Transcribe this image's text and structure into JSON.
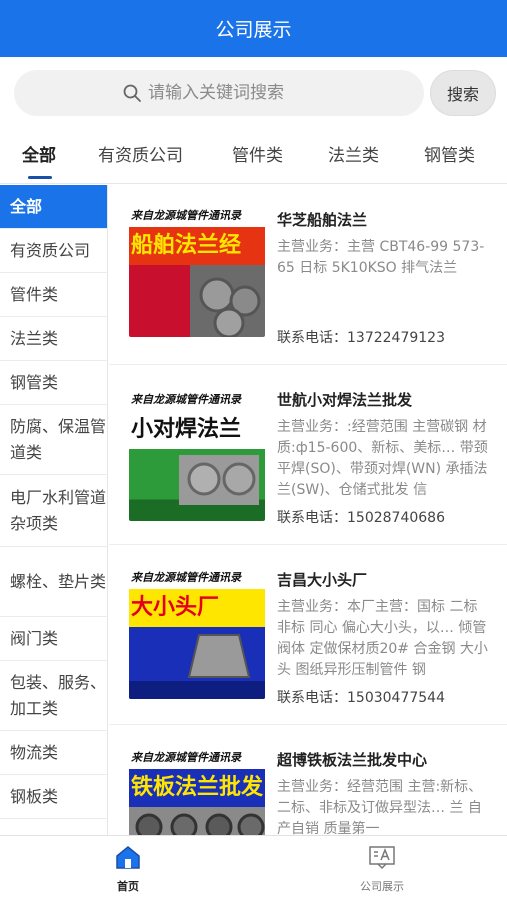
{
  "header": {
    "title": "公司展示"
  },
  "search": {
    "placeholder": "请输入关键词搜索",
    "button_label": "搜索"
  },
  "tabs": [
    {
      "label": "全部",
      "active": true
    },
    {
      "label": "有资质公司"
    },
    {
      "label": "管件类"
    },
    {
      "label": "法兰类"
    },
    {
      "label": "钢管类"
    }
  ],
  "sidebar": {
    "items": [
      {
        "label": "全部",
        "active": true
      },
      {
        "label": "有资质公司"
      },
      {
        "label": "管件类"
      },
      {
        "label": "法兰类"
      },
      {
        "label": "钢管类"
      },
      {
        "label": "防腐、保温管道类"
      },
      {
        "label": "电厂水利管道杂项类"
      },
      {
        "label": "螺栓、垫片类"
      },
      {
        "label": "阀门类"
      },
      {
        "label": "包装、服务、加工类"
      },
      {
        "label": "物流类"
      },
      {
        "label": "钢板类"
      }
    ]
  },
  "companies": [
    {
      "name": "华芝船舶法兰",
      "description": "主营业务：主营 CBT46-99 573-65 日标 5K10KSO 排气法兰",
      "phone": "联系电话：13722479123",
      "thumb_header": "来自龙源城管件通讯录",
      "thumb_title": "船舶法兰经",
      "thumb_colors": {
        "top": "#e63312",
        "bottom": "#c8102e",
        "title": "#ffe600"
      }
    },
    {
      "name": "世航小对焊法兰批发",
      "description": "主营业务：:经营范围 主营碳钢 材质:ф15-600、新标、美标… 带颈平焊(SO)、带颈对焊(WN) 承插法兰(SW)、仓储式批发 信",
      "phone": "联系电话：15028740686",
      "thumb_header": "来自龙源城管件通讯录",
      "thumb_title": "小对焊法兰",
      "thumb_colors": {
        "top": "#ffffff",
        "bottom": "#2e9b3a",
        "title": "#111111"
      }
    },
    {
      "name": "吉昌大小头厂",
      "description": "主营业务：本厂主营：国标 二标 非标 同心 偏心大小头，以… 倾管 阀体 定做保材质20# 合金钢 大小头 图纸异形压制管件 钢",
      "phone": "联系电话：15030477544",
      "thumb_header": "来自龙源城管件通讯录",
      "thumb_title": "大小头厂",
      "thumb_colors": {
        "top": "#ffe600",
        "bottom": "#1a2fb8",
        "title": "#e3001b"
      }
    },
    {
      "name": "超博铁板法兰批发中心",
      "description": "主营业务：经营范围 主营:新标、二标、非标及订做异型法… 兰 自产自销 质量第一",
      "phone": "",
      "thumb_header": "来自龙源城管件通讯录",
      "thumb_title": "铁板法兰批发",
      "thumb_colors": {
        "top": "#1a2fb8",
        "bottom": "#8a8a8a",
        "title": "#ffe600"
      }
    }
  ],
  "bottom_nav": [
    {
      "label": "首页",
      "icon": "home-icon",
      "active": true
    },
    {
      "label": "公司展示",
      "icon": "company-display-icon"
    }
  ],
  "colors": {
    "primary": "#1a73e8",
    "indicator": "#1a4fa8"
  }
}
